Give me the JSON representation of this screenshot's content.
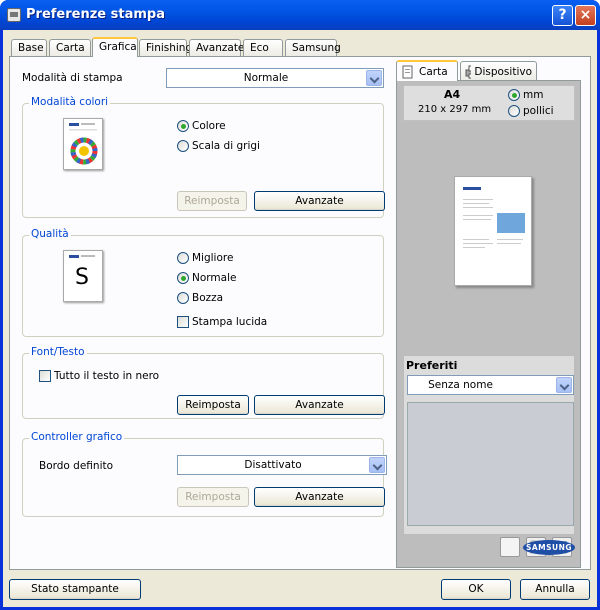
{
  "window": {
    "title": "Preferenze stampa",
    "help_glyph": "?",
    "close_glyph": "×"
  },
  "tabs": [
    "Base",
    "Carta",
    "Grafica",
    "Finishing",
    "Avanzate",
    "Eco",
    "Samsung"
  ],
  "active_tab": "Grafica",
  "print_mode": {
    "label": "Modalità di stampa",
    "value": "Normale"
  },
  "color_mode": {
    "group": "Modalità colori",
    "options": [
      "Colore",
      "Scala di grigi"
    ],
    "selected": "Colore",
    "reset": "Reimposta",
    "advanced": "Avanzate"
  },
  "quality": {
    "group": "Qualità",
    "options": [
      "Migliore",
      "Normale",
      "Bozza"
    ],
    "selected": "Normale",
    "glossy": "Stampa lucida",
    "thumb_letter": "S"
  },
  "font": {
    "group": "Font/Testo",
    "all_black": "Tutto il testo in nero",
    "reset": "Reimposta",
    "advanced": "Avanzate"
  },
  "graphic_controller": {
    "group": "Controller grafico",
    "label": "Bordo definito",
    "value": "Disattivato",
    "reset": "Reimposta",
    "advanced": "Avanzate"
  },
  "right_tabs": [
    "Carta",
    "Dispositivo"
  ],
  "paper": {
    "size": "A4",
    "dims": "210 x 297 mm",
    "units": [
      "mm",
      "pollici"
    ],
    "unit_selected": "mm"
  },
  "preferiti": {
    "label": "Preferiti",
    "value": "Senza nome"
  },
  "brand": {
    "logo": "SAMSUNG",
    "accent": "#1f4ea6"
  },
  "footer": {
    "status": "Stato stampante",
    "ok": "OK",
    "cancel": "Annulla"
  }
}
